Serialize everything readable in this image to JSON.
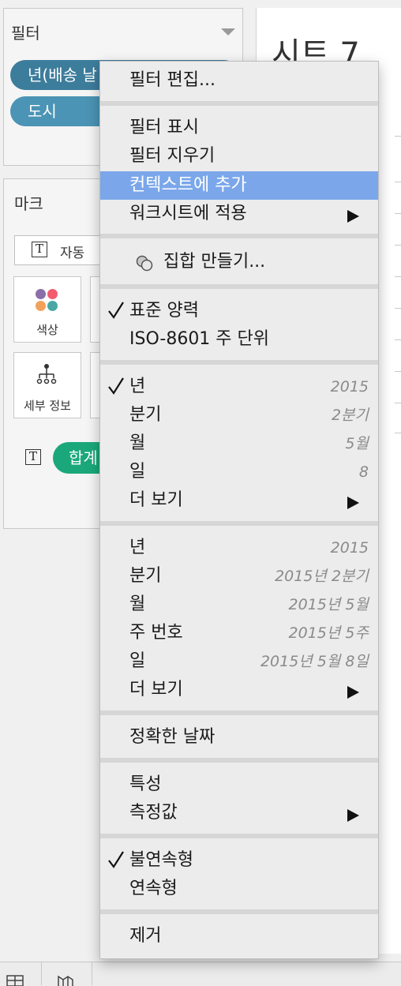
{
  "filters": {
    "title": "필터",
    "pills": [
      "년(배송 날",
      "도시"
    ]
  },
  "marks": {
    "title": "마크",
    "mark_type": "자동",
    "tiles": {
      "color": "색상",
      "detail": "세부 정보"
    },
    "sum_pill": "합계",
    "text_icon": "T",
    "color_dots": [
      "#8a6fa8",
      "#f25c70",
      "#f2a25c",
      "#4aa8a4"
    ]
  },
  "sheet": {
    "title": "시트 7"
  },
  "menu": {
    "edit_filter": "필터 편집...",
    "show_filter": "필터 표시",
    "clear_filter": "필터 지우기",
    "add_to_context": "컨텍스트에 추가",
    "apply_to_worksheets": "워크시트에 적용",
    "create_set": "집합 만들기...",
    "standard_calendar": "표준 양력",
    "iso_week": "ISO-8601 주 단위",
    "discrete_parts": [
      {
        "label": "년",
        "value": "2015",
        "checked": true
      },
      {
        "label": "분기",
        "value": "2분기"
      },
      {
        "label": "월",
        "value": "5월"
      },
      {
        "label": "일",
        "value": "8"
      },
      {
        "label": "더 보기"
      }
    ],
    "continuous_parts": [
      {
        "label": "년",
        "value": "2015"
      },
      {
        "label": "분기",
        "value": "2015년 2분기"
      },
      {
        "label": "월",
        "value": "2015년 5월"
      },
      {
        "label": "주 번호",
        "value": "2015년 5주"
      },
      {
        "label": "일",
        "value": "2015년 5월 8일"
      },
      {
        "label": "더 보기"
      }
    ],
    "exact_date": "정확한 날짜",
    "attribute": "특성",
    "measure": "측정값",
    "discrete": "불연속형",
    "continuous": "연속형",
    "remove": "제거",
    "highlight_color": "#7ba7ea"
  }
}
